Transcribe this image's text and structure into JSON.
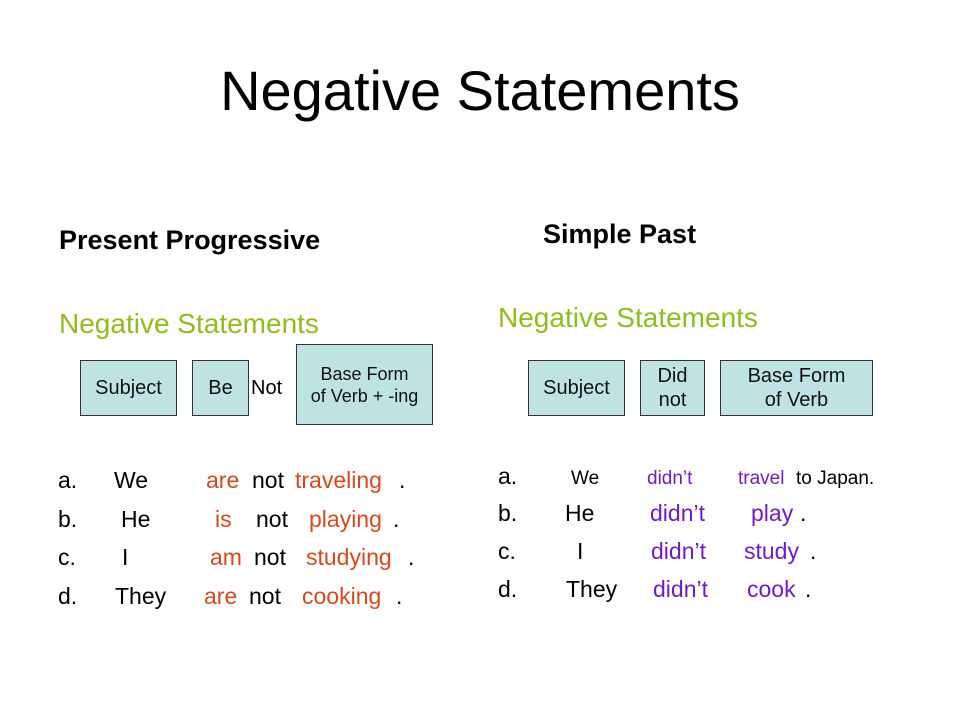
{
  "title": "Negative Statements",
  "colors": {
    "accent_green": "#8fbc1e",
    "present_highlight": "#d24a1e",
    "past_highlight": "#6f1bc6",
    "box_fill": "#bfe3e4"
  },
  "left": {
    "heading": "Present Progressive",
    "subheading": "Negative Statements",
    "formula": {
      "subject": "Subject",
      "be": "Be",
      "not": "Not",
      "verb_line1": "Base Form",
      "verb_line2": "of Verb + -ing"
    },
    "examples": [
      {
        "label": "a.",
        "subject": "We",
        "aux": "are",
        "neg": "not",
        "verb": "traveling",
        "end": "."
      },
      {
        "label": "b.",
        "subject": "He",
        "aux": "is",
        "neg": "not",
        "verb": "playing",
        "end": "."
      },
      {
        "label": "c.",
        "subject": "I",
        "aux": "am",
        "neg": "not",
        "verb": "studying",
        "end": "."
      },
      {
        "label": "d.",
        "subject": "They",
        "aux": "are",
        "neg": "not",
        "verb": "cooking",
        "end": "."
      }
    ]
  },
  "right": {
    "heading": "Simple Past",
    "subheading": "Negative Statements",
    "formula": {
      "subject": "Subject",
      "did_line1": "Did",
      "did_line2": "not",
      "verb_line1": "Base Form",
      "verb_line2": "of Verb"
    },
    "examples": [
      {
        "label": "a.",
        "subject": "We",
        "aux": "didn’t",
        "verb": "travel",
        "rest": " to Japan."
      },
      {
        "label": "b.",
        "subject": "He",
        "aux": "didn’t",
        "verb": "play",
        "rest": "."
      },
      {
        "label": "c.",
        "subject": "I",
        "aux": "didn’t",
        "verb": "study",
        "rest": "."
      },
      {
        "label": "d.",
        "subject": "They",
        "aux": "didn’t",
        "verb": "cook",
        "rest": "."
      }
    ]
  }
}
